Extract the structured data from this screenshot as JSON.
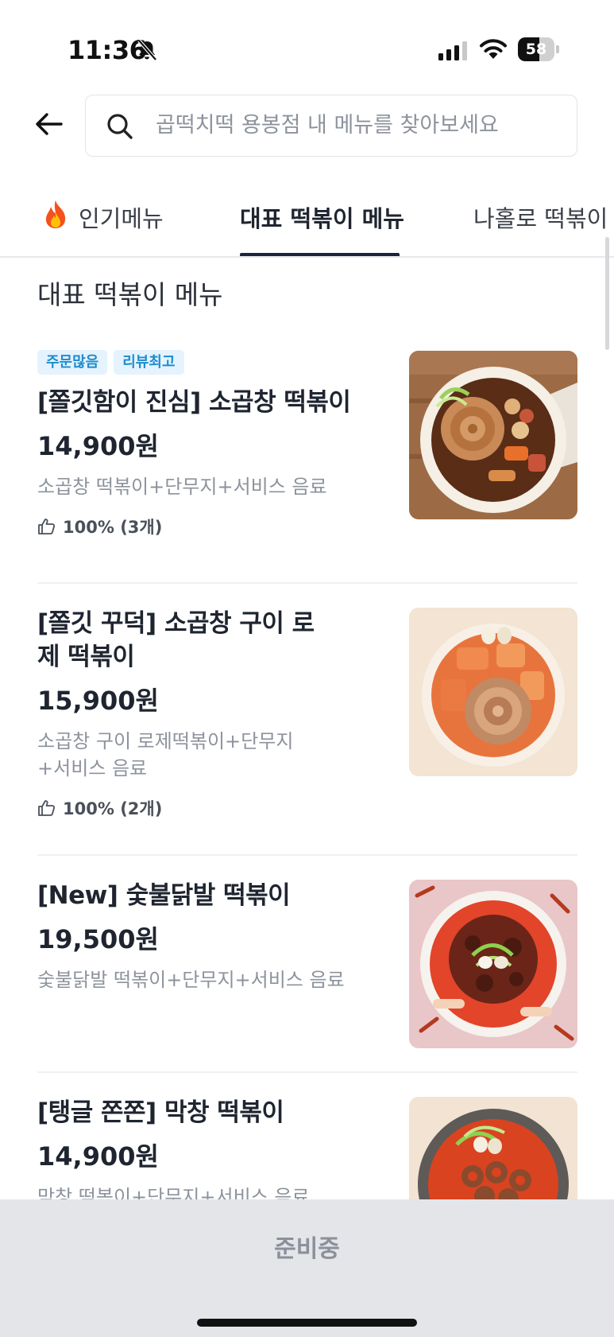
{
  "status_bar": {
    "time": "11:36",
    "battery_level": "58",
    "battery_fraction": 0.58
  },
  "search": {
    "placeholder": "곱떡치떡 용봉점 내 메뉴를 찾아보세요",
    "value": ""
  },
  "tabs": [
    {
      "label": "인기메뉴",
      "icon": "fire-icon",
      "active": false
    },
    {
      "label": "대표 떡볶이 메뉴",
      "active": true
    },
    {
      "label": "나홀로 떡볶이",
      "active": false
    }
  ],
  "section": {
    "title": "대표 떡볶이 메뉴"
  },
  "menu_items": [
    {
      "badges": [
        "주문많음",
        "리뷰최고"
      ],
      "name": "[쫄깃함이 진심] 소곱창 떡볶이",
      "price": "14,900원",
      "description": "소곱창 떡볶이+단무지+서비스 음료",
      "like": "100% (3개)",
      "image": "gopchang-tteokbokki-photo"
    },
    {
      "badges": [],
      "name": "[쫄깃 꾸덕] 소곱창 구이 로제 떡볶이",
      "price": "15,900원",
      "description": "소곱창 구이 로제떡볶이+단무지 +서비스 음료",
      "like": "100% (2개)",
      "image": "rose-tteokbokki-photo"
    },
    {
      "badges": [],
      "name": "[New] 숯불닭발 떡볶이",
      "price": "19,500원",
      "description": "숯불닭발 떡볶이+단무지+서비스 음료",
      "like": "",
      "image": "chicken-feet-tteokbokki-photo"
    },
    {
      "badges": [],
      "name": "[탱글 쫀쫀] 막창 떡볶이",
      "price": "14,900원",
      "description": "막창 떡볶이+단무지+서비스 음료",
      "like": "",
      "image": "makchang-tteokbokki-photo"
    }
  ],
  "bottom_bar": {
    "status": "준비중"
  },
  "colors": {
    "badge_bg": "#e4f3fd",
    "badge_text": "#1e8ccd",
    "tab_underline": "#1e2140",
    "bottom_bar_bg": "#e3e5e9"
  }
}
